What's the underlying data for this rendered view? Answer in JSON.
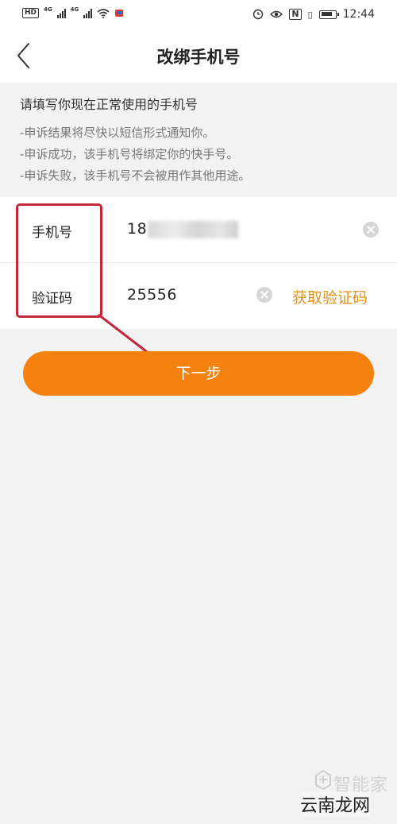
{
  "status_bar": {
    "hd_badge": "HD",
    "network_1": "4G",
    "network_2": "4G",
    "nfc_label": "N",
    "time": "12:44"
  },
  "header": {
    "title": "改绑手机号"
  },
  "notice": {
    "heading": "请填写你现在正常使用的手机号",
    "items": [
      "-申诉结果将尽快以短信形式通知你。",
      "-申诉成功，该手机号将绑定你的快手号。",
      "-申诉失败，该手机号不会被用作其他用途。"
    ]
  },
  "form": {
    "phone": {
      "label": "手机号",
      "value": "18"
    },
    "code": {
      "label": "验证码",
      "value": "25556",
      "get_code_label": "获取验证码"
    }
  },
  "next_button": {
    "label": "下一步"
  },
  "annotation": {
    "color": "#c3283a"
  },
  "watermark": {
    "logo_text": "智能家",
    "site_text": "云南龙网"
  },
  "colors": {
    "accent": "#f5820f",
    "link": "#e39418"
  }
}
